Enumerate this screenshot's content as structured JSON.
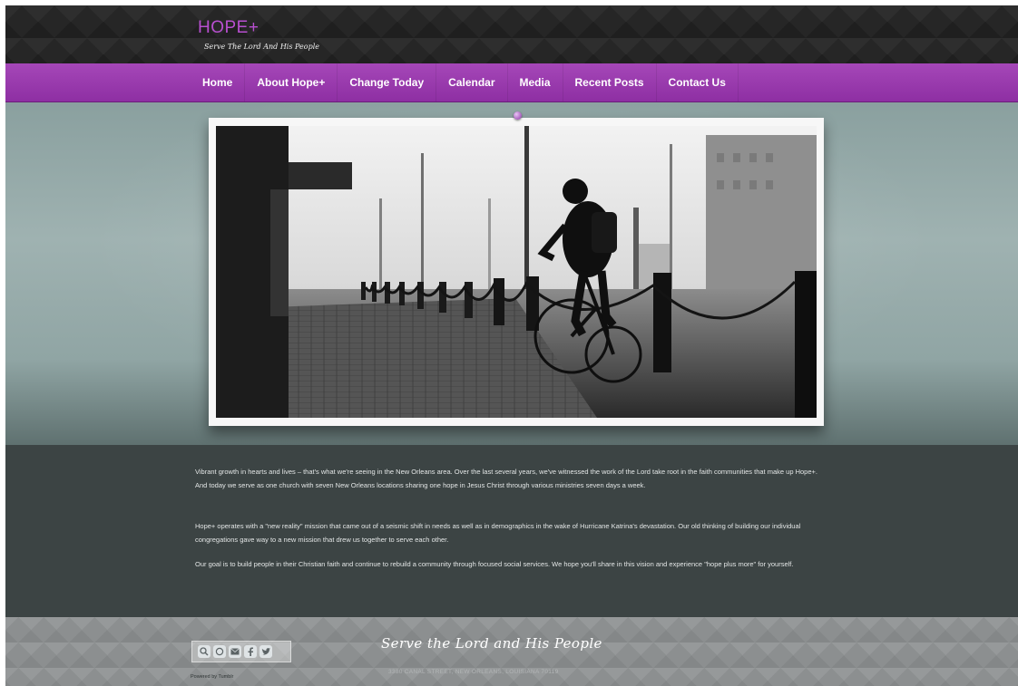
{
  "header": {
    "brand": "HOPE+",
    "tagline": "Serve The Lord And His People"
  },
  "nav": {
    "items": [
      {
        "label": "Home"
      },
      {
        "label": "About Hope+"
      },
      {
        "label": "Change Today"
      },
      {
        "label": "Calendar"
      },
      {
        "label": "Media"
      },
      {
        "label": "Recent Posts"
      },
      {
        "label": "Contact Us"
      }
    ]
  },
  "content": {
    "paragraphs": [
      "Vibrant growth in hearts and lives – that's what we're seeing in the New Orleans area. Over the last several years, we've witnessed the work of the Lord take root in the faith communities that make up Hope+. And today we serve as one church with seven New Orleans locations sharing one hope in Jesus Christ through various ministries seven days a week.",
      "Hope+ operates with a \"new reality\" mission that came out of a seismic shift in needs as well as in demographics in the wake of Hurricane Katrina's devastation. Our old thinking of building our individual congregations gave way to a new mission that drew us together to serve each other.",
      "Our goal is to build people in their Christian faith and continue to rebuild a community through focused social services. We hope you'll share in this vision and experience \"hope plus more\" for yourself."
    ]
  },
  "footer": {
    "tagline": "Serve the Lord and His People",
    "address": "3380 CANAL STREET, NEW ORLEANS, LOUISIANA 70119",
    "powered_by": "Powered by Tumblr",
    "social_icons": [
      "search-icon",
      "rss-icon",
      "email-icon",
      "facebook-icon",
      "twitter-icon"
    ]
  },
  "colors": {
    "accent": "#9c3fb0",
    "brand_text": "#b84fd0",
    "header_bg": "#262626",
    "content_bg": "#3c4444",
    "footer_bg": "#8c8f90"
  }
}
